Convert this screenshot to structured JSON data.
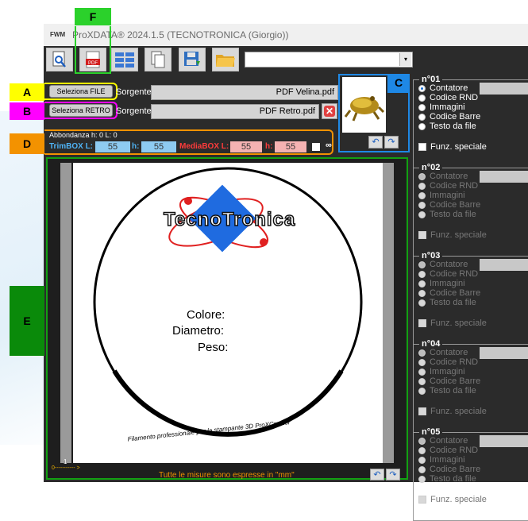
{
  "window": {
    "title": "ProXDATA® 2024.1.5  (TECNOTRONICA (Giorgio))",
    "logo_text": "FWM"
  },
  "toolbar": {
    "items": [
      {
        "name": "preview",
        "icon": "magnifier-page-icon"
      },
      {
        "name": "pdf",
        "icon": "pdf-icon",
        "label": "PDF"
      },
      {
        "name": "grid",
        "icon": "grid-icon"
      },
      {
        "name": "copy",
        "icon": "copy-pages-icon"
      },
      {
        "name": "save",
        "icon": "save-icon"
      },
      {
        "name": "open",
        "icon": "folder-icon"
      }
    ],
    "combo_value": ""
  },
  "callouts": {
    "a": "A",
    "b": "B",
    "c": "C",
    "d": "D",
    "e": "E",
    "f": "F"
  },
  "colors": {
    "callout_a": "#ffff00",
    "callout_b": "#ff00ff",
    "callout_c": "#1e88e5",
    "callout_d": "#f39200",
    "callout_e": "#0a8a0a",
    "callout_f": "#2bd12b"
  },
  "source": {
    "file_button": "Seleziona FILE",
    "retro_button": "Seleziona RETRO",
    "label": "Sorgente:",
    "file_value": "PDF Velina.pdf",
    "retro_value": "PDF Retro.pdf"
  },
  "dims": {
    "bleed": "Abbondanza h: 0  L: 0",
    "trim_label": "TrimBOX L:",
    "trim_l": "55",
    "h_label": "h:",
    "trim_h": "55",
    "media_label": "MediaBOX L:",
    "media_l": "55",
    "media_h": "55",
    "infinity": "∞"
  },
  "preview_page": {
    "brand": "TecnoTronica",
    "field1": "Colore:",
    "field2": "Diametro:",
    "field3": "Peso:",
    "arc_text": "Filamento professionale per la stampante 3D ProXCreator",
    "corner_num": "1"
  },
  "footer": {
    "note": "Tutte le misure sono espresse in \"mm\"",
    "ruler": "0----------- >"
  },
  "fields": [
    {
      "title": "n°01",
      "active": true,
      "options": [
        "Contatore",
        "Codice RND",
        "Immagini",
        "Codice Barre",
        "Testo da file"
      ],
      "special": "Funz. speciale"
    },
    {
      "title": "n°02",
      "active": false,
      "options": [
        "Contatore",
        "Codice RND",
        "Immagini",
        "Codice Barre",
        "Testo da file"
      ],
      "special": "Funz. speciale"
    },
    {
      "title": "n°03",
      "active": false,
      "options": [
        "Contatore",
        "Codice RND",
        "Immagini",
        "Codice Barre",
        "Testo da file"
      ],
      "special": "Funz. speciale"
    },
    {
      "title": "n°04",
      "active": false,
      "options": [
        "Contatore",
        "Codice RND",
        "Immagini",
        "Codice Barre",
        "Testo da file"
      ],
      "special": "Funz. speciale"
    },
    {
      "title": "n°05",
      "active": false,
      "options": [
        "Contatore",
        "Codice RND",
        "Immagini",
        "Codice Barre",
        "Testo da file"
      ],
      "special": "Funz. speciale"
    }
  ]
}
